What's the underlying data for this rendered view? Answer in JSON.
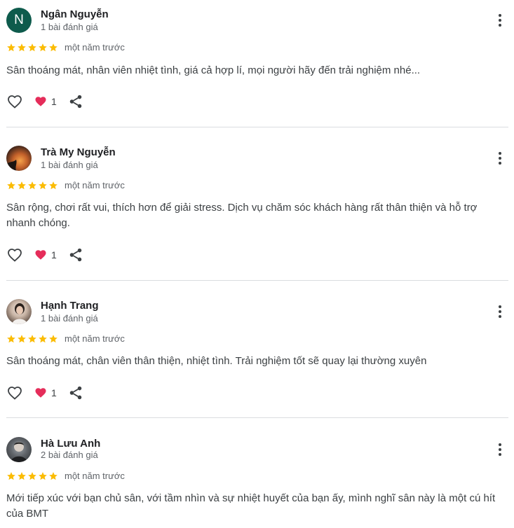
{
  "reviews": [
    {
      "name": "Ngân Nguyễn",
      "avatar_initial": "N",
      "review_count": "1 bài đánh giá",
      "rating": 5,
      "time": "một năm trước",
      "text": "Sân thoáng mát, nhân viên nhiệt tình, giá cả hợp lí, mọi người hãy đến trải nghiệm nhé...",
      "likes": "1"
    },
    {
      "name": "Trà My Nguyễn",
      "review_count": "1 bài đánh giá",
      "rating": 5,
      "time": "một năm trước",
      "text": "Sân rộng, chơi rất vui, thích hơn để giải stress. Dịch vụ chăm sóc khách hàng rất thân thiện và hỗ trợ nhanh chóng.",
      "likes": "1"
    },
    {
      "name": "Hạnh Trang",
      "review_count": "1 bài đánh giá",
      "rating": 5,
      "time": "một năm trước",
      "text": "Sân thoáng mát, chân viên thân thiện, nhiệt tình. Trải nghiệm tốt sẽ quay lại thường xuyên",
      "likes": "1"
    },
    {
      "name": "Hà Lưu Anh",
      "review_count": "2 bài đánh giá",
      "rating": 5,
      "time": "một năm trước",
      "text": "Mới tiếp xúc với bạn chủ sân, với tầm nhìn và sự nhiệt huyết của bạn ấy, mình nghĩ sân này là một cú hít của BMT"
    }
  ],
  "colors": {
    "star": "#fbbc04",
    "heart": "#e52d5a",
    "avatar_initial_bg": "#0e5b4c",
    "divider": "#dadce0"
  },
  "icons": [
    "star-icon",
    "heart-outline-icon",
    "heart-filled-icon",
    "share-icon",
    "more-vert-icon"
  ]
}
